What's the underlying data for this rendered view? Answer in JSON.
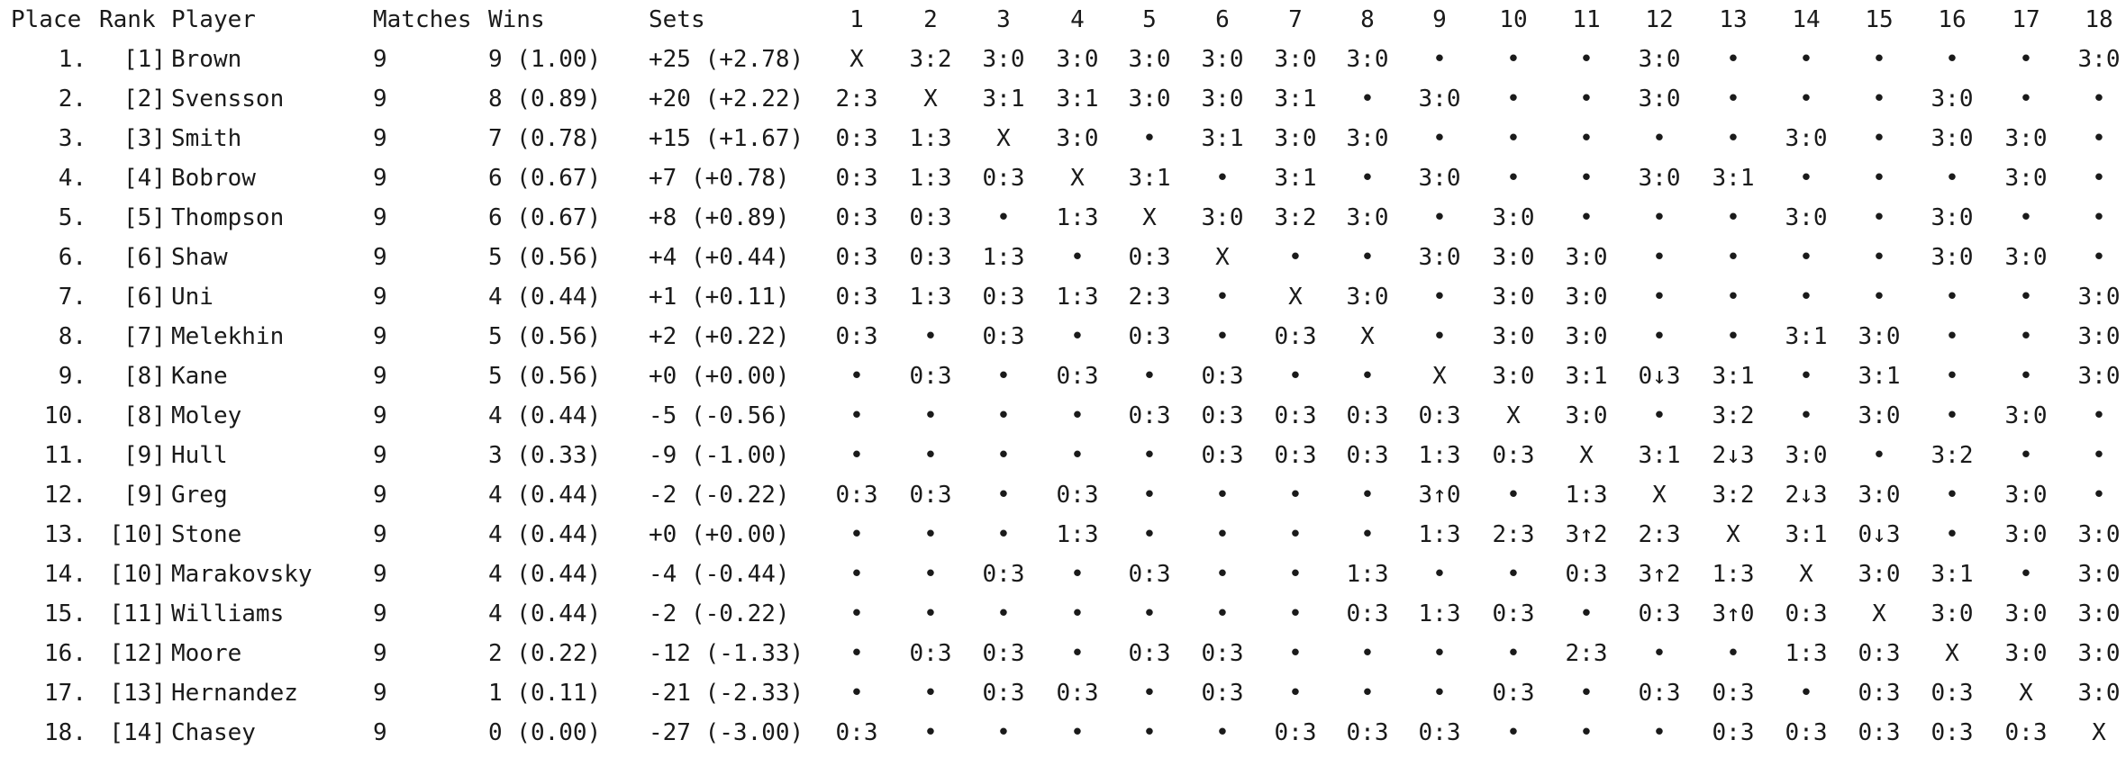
{
  "table": {
    "headers": {
      "place": "Place",
      "rank": "Rank",
      "player": "Player",
      "matches": "Matches",
      "wins": "Wins",
      "sets": "Sets",
      "rounds": [
        "1",
        "2",
        "3",
        "4",
        "5",
        "6",
        "7",
        "8",
        "9",
        "10",
        "11",
        "12",
        "13",
        "14",
        "15",
        "16",
        "17",
        "18"
      ]
    },
    "rows": [
      {
        "place": "1.",
        "rank": "[1]",
        "player": "Brown",
        "matches": "9",
        "wins": "9 (1.00)",
        "sets": "+25 (+2.78)",
        "results": [
          "X",
          "3:2",
          "3:0",
          "3:0",
          "3:0",
          "3:0",
          "3:0",
          "3:0",
          "•",
          "•",
          "•",
          "3:0",
          "•",
          "•",
          "•",
          "•",
          "•",
          "3:0"
        ]
      },
      {
        "place": "2.",
        "rank": "[2]",
        "player": "Svensson",
        "matches": "9",
        "wins": "8 (0.89)",
        "sets": "+20 (+2.22)",
        "results": [
          "2:3",
          "X",
          "3:1",
          "3:1",
          "3:0",
          "3:0",
          "3:1",
          "•",
          "3:0",
          "•",
          "•",
          "3:0",
          "•",
          "•",
          "•",
          "3:0",
          "•",
          "•"
        ]
      },
      {
        "place": "3.",
        "rank": "[3]",
        "player": "Smith",
        "matches": "9",
        "wins": "7 (0.78)",
        "sets": "+15 (+1.67)",
        "results": [
          "0:3",
          "1:3",
          "X",
          "3:0",
          "•",
          "3:1",
          "3:0",
          "3:0",
          "•",
          "•",
          "•",
          "•",
          "•",
          "3:0",
          "•",
          "3:0",
          "3:0",
          "•"
        ]
      },
      {
        "place": "4.",
        "rank": "[4]",
        "player": "Bobrow",
        "matches": "9",
        "wins": "6 (0.67)",
        "sets": "+7 (+0.78)",
        "results": [
          "0:3",
          "1:3",
          "0:3",
          "X",
          "3:1",
          "•",
          "3:1",
          "•",
          "3:0",
          "•",
          "•",
          "3:0",
          "3:1",
          "•",
          "•",
          "•",
          "3:0",
          "•"
        ]
      },
      {
        "place": "5.",
        "rank": "[5]",
        "player": "Thompson",
        "matches": "9",
        "wins": "6 (0.67)",
        "sets": "+8 (+0.89)",
        "results": [
          "0:3",
          "0:3",
          "•",
          "1:3",
          "X",
          "3:0",
          "3:2",
          "3:0",
          "•",
          "3:0",
          "•",
          "•",
          "•",
          "3:0",
          "•",
          "3:0",
          "•",
          "•"
        ]
      },
      {
        "place": "6.",
        "rank": "[6]",
        "player": "Shaw",
        "matches": "9",
        "wins": "5 (0.56)",
        "sets": "+4 (+0.44)",
        "results": [
          "0:3",
          "0:3",
          "1:3",
          "•",
          "0:3",
          "X",
          "•",
          "•",
          "3:0",
          "3:0",
          "3:0",
          "•",
          "•",
          "•",
          "•",
          "3:0",
          "3:0",
          "•"
        ]
      },
      {
        "place": "7.",
        "rank": "[6]",
        "player": "Uni",
        "matches": "9",
        "wins": "4 (0.44)",
        "sets": "+1 (+0.11)",
        "results": [
          "0:3",
          "1:3",
          "0:3",
          "1:3",
          "2:3",
          "•",
          "X",
          "3:0",
          "•",
          "3:0",
          "3:0",
          "•",
          "•",
          "•",
          "•",
          "•",
          "•",
          "3:0"
        ]
      },
      {
        "place": "8.",
        "rank": "[7]",
        "player": "Melekhin",
        "matches": "9",
        "wins": "5 (0.56)",
        "sets": "+2 (+0.22)",
        "results": [
          "0:3",
          "•",
          "0:3",
          "•",
          "0:3",
          "•",
          "0:3",
          "X",
          "•",
          "3:0",
          "3:0",
          "•",
          "•",
          "3:1",
          "3:0",
          "•",
          "•",
          "3:0"
        ]
      },
      {
        "place": "9.",
        "rank": "[8]",
        "player": "Kane",
        "matches": "9",
        "wins": "5 (0.56)",
        "sets": "+0 (+0.00)",
        "results": [
          "•",
          "0:3",
          "•",
          "0:3",
          "•",
          "0:3",
          "•",
          "•",
          "X",
          "3:0",
          "3:1",
          "0↓3",
          "3:1",
          "•",
          "3:1",
          "•",
          "•",
          "3:0"
        ]
      },
      {
        "place": "10.",
        "rank": "[8]",
        "player": "Moley",
        "matches": "9",
        "wins": "4 (0.44)",
        "sets": "-5 (-0.56)",
        "results": [
          "•",
          "•",
          "•",
          "•",
          "0:3",
          "0:3",
          "0:3",
          "0:3",
          "0:3",
          "X",
          "3:0",
          "•",
          "3:2",
          "•",
          "3:0",
          "•",
          "3:0",
          "•"
        ]
      },
      {
        "place": "11.",
        "rank": "[9]",
        "player": "Hull",
        "matches": "9",
        "wins": "3 (0.33)",
        "sets": "-9 (-1.00)",
        "results": [
          "•",
          "•",
          "•",
          "•",
          "•",
          "0:3",
          "0:3",
          "0:3",
          "1:3",
          "0:3",
          "X",
          "3:1",
          "2↓3",
          "3:0",
          "•",
          "3:2",
          "•",
          "•"
        ]
      },
      {
        "place": "12.",
        "rank": "[9]",
        "player": "Greg",
        "matches": "9",
        "wins": "4 (0.44)",
        "sets": "-2 (-0.22)",
        "results": [
          "0:3",
          "0:3",
          "•",
          "0:3",
          "•",
          "•",
          "•",
          "•",
          "3↑0",
          "•",
          "1:3",
          "X",
          "3:2",
          "2↓3",
          "3:0",
          "•",
          "3:0",
          "•"
        ]
      },
      {
        "place": "13.",
        "rank": "[10]",
        "player": "Stone",
        "matches": "9",
        "wins": "4 (0.44)",
        "sets": "+0 (+0.00)",
        "results": [
          "•",
          "•",
          "•",
          "1:3",
          "•",
          "•",
          "•",
          "•",
          "1:3",
          "2:3",
          "3↑2",
          "2:3",
          "X",
          "3:1",
          "0↓3",
          "•",
          "3:0",
          "3:0"
        ]
      },
      {
        "place": "14.",
        "rank": "[10]",
        "player": "Marakovsky",
        "matches": "9",
        "wins": "4 (0.44)",
        "sets": "-4 (-0.44)",
        "results": [
          "•",
          "•",
          "0:3",
          "•",
          "0:3",
          "•",
          "•",
          "1:3",
          "•",
          "•",
          "0:3",
          "3↑2",
          "1:3",
          "X",
          "3:0",
          "3:1",
          "•",
          "3:0"
        ]
      },
      {
        "place": "15.",
        "rank": "[11]",
        "player": "Williams",
        "matches": "9",
        "wins": "4 (0.44)",
        "sets": "-2 (-0.22)",
        "results": [
          "•",
          "•",
          "•",
          "•",
          "•",
          "•",
          "•",
          "0:3",
          "1:3",
          "0:3",
          "•",
          "0:3",
          "3↑0",
          "0:3",
          "X",
          "3:0",
          "3:0",
          "3:0"
        ]
      },
      {
        "place": "16.",
        "rank": "[12]",
        "player": "Moore",
        "matches": "9",
        "wins": "2 (0.22)",
        "sets": "-12 (-1.33)",
        "results": [
          "•",
          "0:3",
          "0:3",
          "•",
          "0:3",
          "0:3",
          "•",
          "•",
          "•",
          "•",
          "2:3",
          "•",
          "•",
          "1:3",
          "0:3",
          "X",
          "3:0",
          "3:0"
        ]
      },
      {
        "place": "17.",
        "rank": "[13]",
        "player": "Hernandez",
        "matches": "9",
        "wins": "1 (0.11)",
        "sets": "-21 (-2.33)",
        "results": [
          "•",
          "•",
          "0:3",
          "0:3",
          "•",
          "0:3",
          "•",
          "•",
          "•",
          "0:3",
          "•",
          "0:3",
          "0:3",
          "•",
          "0:3",
          "0:3",
          "X",
          "3:0"
        ]
      },
      {
        "place": "18.",
        "rank": "[14]",
        "player": "Chasey",
        "matches": "9",
        "wins": "0 (0.00)",
        "sets": "-27 (-3.00)",
        "results": [
          "0:3",
          "•",
          "•",
          "•",
          "•",
          "•",
          "0:3",
          "0:3",
          "0:3",
          "•",
          "•",
          "•",
          "0:3",
          "0:3",
          "0:3",
          "0:3",
          "0:3",
          "X"
        ]
      }
    ]
  }
}
